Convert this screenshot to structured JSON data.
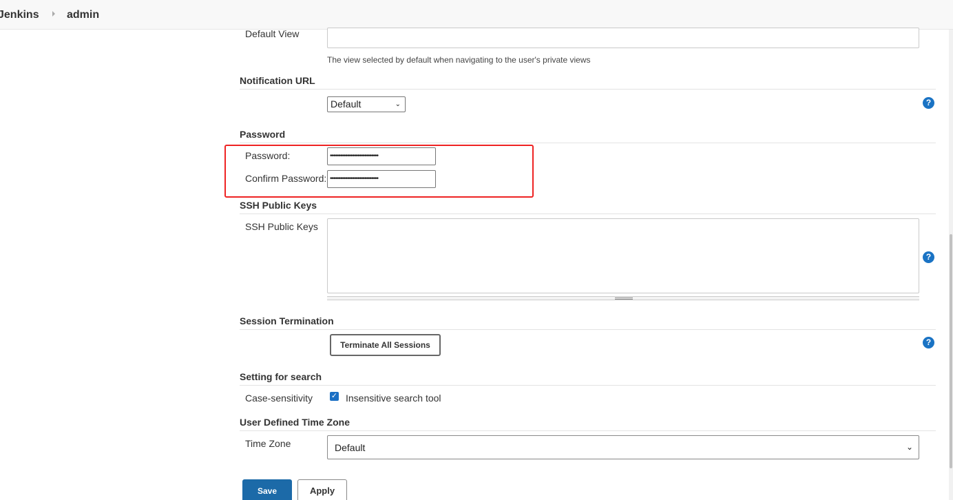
{
  "breadcrumb": {
    "root": "Jenkins",
    "user": "admin"
  },
  "default_view": {
    "label": "Default View",
    "value": "",
    "description": "The view selected by default when navigating to the user's private views"
  },
  "notification_url": {
    "section_title": "Notification URL",
    "selected": "Default",
    "chevron": "⌄"
  },
  "password": {
    "section_title": "Password",
    "password_label": "Password:",
    "password_value": "••••••••••••••••••••••••••••",
    "confirm_label": "Confirm Password:",
    "confirm_value": "••••••••••••••••••••••••••••"
  },
  "ssh": {
    "section_title": "SSH Public Keys",
    "label": "SSH Public Keys",
    "value": ""
  },
  "session": {
    "section_title": "Session Termination",
    "button_label": "Terminate All Sessions"
  },
  "search": {
    "section_title": "Setting for search",
    "label": "Case-sensitivity",
    "checkbox_label": "Insensitive search tool",
    "checked": true,
    "check_glyph": "✓"
  },
  "timezone": {
    "section_title": "User Defined Time Zone",
    "label": "Time Zone",
    "selected": "Default",
    "chevron": "⌄"
  },
  "help_glyph": "?",
  "actions": {
    "save_label": "Save",
    "apply_label": "Apply"
  },
  "colors": {
    "accent": "#1c6aa8",
    "help": "#1a73c4",
    "highlight": "#ee2222"
  }
}
